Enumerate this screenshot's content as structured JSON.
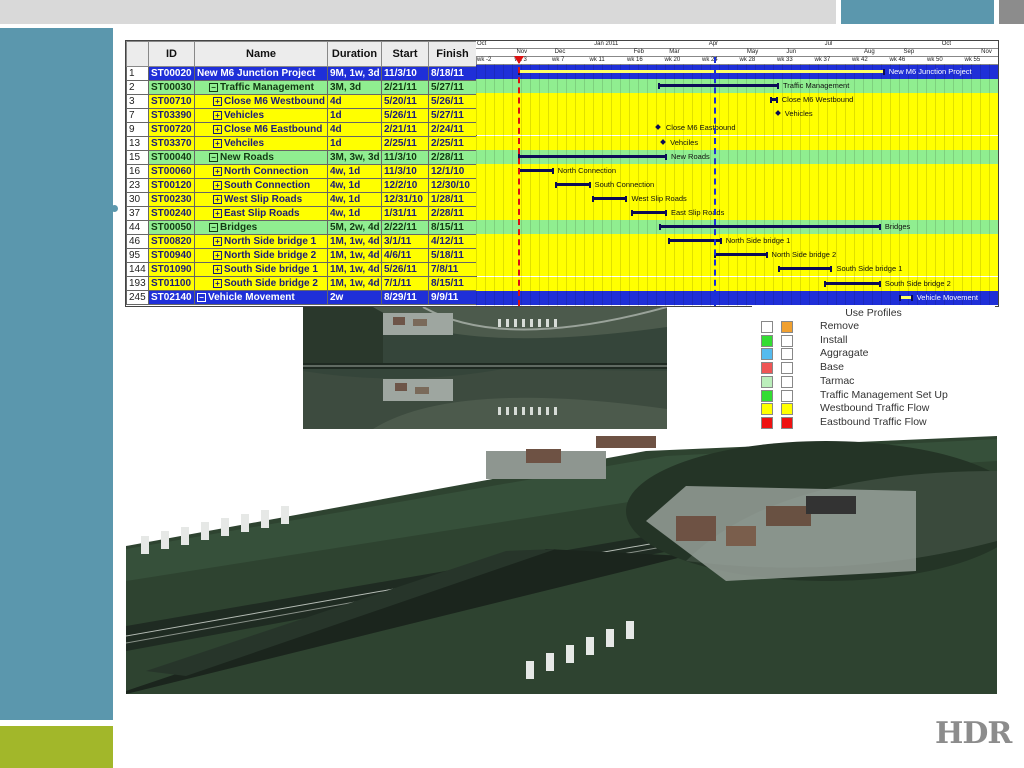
{
  "slide": {
    "logo_text": "HDR",
    "colors": {
      "teal": "#5b97ad",
      "green": "#a2b72a",
      "gray": "#d9d9d9"
    }
  },
  "gantt": {
    "columns": [
      "ID",
      "Name",
      "Duration",
      "Start",
      "Finish"
    ],
    "rows": [
      {
        "num": "1",
        "id": "ST00020",
        "name": "New M6 Junction Project",
        "duration": "9M, 1w, 3d",
        "start": "11/3/10",
        "finish": "8/18/11",
        "type": "project",
        "toggle": "−"
      },
      {
        "num": "2",
        "id": "ST00030",
        "name": "Traffic Management",
        "duration": "3M, 3d",
        "start": "2/21/11",
        "finish": "5/27/11",
        "type": "summary",
        "toggle": "−"
      },
      {
        "num": "3",
        "id": "ST00710",
        "name": "Close M6 Westbound",
        "duration": "4d",
        "start": "5/20/11",
        "finish": "5/26/11",
        "type": "task",
        "toggle": "+"
      },
      {
        "num": "7",
        "id": "ST03390",
        "name": "Vehicles",
        "duration": "1d",
        "start": "5/26/11",
        "finish": "5/27/11",
        "type": "task",
        "toggle": "+"
      },
      {
        "num": "9",
        "id": "ST00720",
        "name": "Close M6 Eastbound",
        "duration": "4d",
        "start": "2/21/11",
        "finish": "2/24/11",
        "type": "task",
        "toggle": "+"
      },
      {
        "num": "13",
        "id": "ST03370",
        "name": "Vehciles",
        "duration": "1d",
        "start": "2/25/11",
        "finish": "2/25/11",
        "type": "task",
        "toggle": "+"
      },
      {
        "num": "15",
        "id": "ST00040",
        "name": "New Roads",
        "duration": "3M, 3w, 3d",
        "start": "11/3/10",
        "finish": "2/28/11",
        "type": "summary",
        "toggle": "−"
      },
      {
        "num": "16",
        "id": "ST00060",
        "name": "North Connection",
        "duration": "4w, 1d",
        "start": "11/3/10",
        "finish": "12/1/10",
        "type": "task",
        "toggle": "+"
      },
      {
        "num": "23",
        "id": "ST00120",
        "name": "South Connection",
        "duration": "4w, 1d",
        "start": "12/2/10",
        "finish": "12/30/10",
        "type": "task",
        "toggle": "+"
      },
      {
        "num": "30",
        "id": "ST00230",
        "name": "West Slip Roads",
        "duration": "4w, 1d",
        "start": "12/31/10",
        "finish": "1/28/11",
        "type": "task",
        "toggle": "+"
      },
      {
        "num": "37",
        "id": "ST00240",
        "name": "East Slip Roads",
        "duration": "4w, 1d",
        "start": "1/31/11",
        "finish": "2/28/11",
        "type": "task",
        "toggle": "+"
      },
      {
        "num": "44",
        "id": "ST00050",
        "name": "Bridges",
        "duration": "5M, 2w, 4d",
        "start": "2/22/11",
        "finish": "8/15/11",
        "type": "summary",
        "toggle": "−"
      },
      {
        "num": "46",
        "id": "ST00820",
        "name": "North Side bridge 1",
        "duration": "1M, 1w, 4d",
        "start": "3/1/11",
        "finish": "4/12/11",
        "type": "task",
        "toggle": "+"
      },
      {
        "num": "95",
        "id": "ST00940",
        "name": "North Side bridge 2",
        "duration": "1M, 1w, 4d",
        "start": "4/6/11",
        "finish": "5/18/11",
        "type": "task",
        "toggle": "+"
      },
      {
        "num": "144",
        "id": "ST01090",
        "name": "South Side bridge 1",
        "duration": "1M, 1w, 4d",
        "start": "5/26/11",
        "finish": "7/8/11",
        "type": "task",
        "toggle": "+"
      },
      {
        "num": "193",
        "id": "ST01100",
        "name": "South Side bridge 2",
        "duration": "1M, 1w, 4d",
        "start": "7/1/11",
        "finish": "8/15/11",
        "type": "task",
        "toggle": "+"
      },
      {
        "num": "245",
        "id": "ST02140",
        "name": "Vehicle Movement",
        "duration": "2w",
        "start": "8/29/11",
        "finish": "9/9/11",
        "type": "move",
        "toggle": "−"
      }
    ],
    "timeline": {
      "year_labels": [
        "Oct",
        "Jan 2011",
        "Apr",
        "Jul",
        "Oct"
      ],
      "month_labels": [
        "Nov",
        "Dec",
        "Feb",
        "Mar",
        "May",
        "Jun",
        "Aug",
        "Sep",
        "Nov"
      ],
      "week_labels": [
        "wk -2",
        "wk 3",
        "wk 7",
        "wk 11",
        "wk 16",
        "wk 20",
        "wk 24",
        "wk 28",
        "wk 33",
        "wk 37",
        "wk 42",
        "wk 46",
        "wk 50",
        "wk 55"
      ]
    },
    "bars": [
      {
        "label": "New M6 Junction Project",
        "start": "11/3/10",
        "finish": "8/18/11"
      },
      {
        "label": "Traffic Management",
        "start": "2/21/11",
        "finish": "5/27/11"
      },
      {
        "label": "Close M6 Westbound",
        "start": "5/20/11",
        "finish": "5/26/11"
      },
      {
        "label": "Vehicles",
        "start": "5/26/11",
        "finish": "5/27/11"
      },
      {
        "label": "Close M6 Eastbound",
        "start": "2/21/11",
        "finish": "2/24/11"
      },
      {
        "label": "Vehciles",
        "start": "2/25/11",
        "finish": "2/25/11"
      },
      {
        "label": "New Roads",
        "start": "11/3/10",
        "finish": "2/28/11"
      },
      {
        "label": "North Connection",
        "start": "11/3/10",
        "finish": "12/1/10"
      },
      {
        "label": "South Connection",
        "start": "12/2/10",
        "finish": "12/30/10"
      },
      {
        "label": "West Slip Roads",
        "start": "12/31/10",
        "finish": "1/28/11"
      },
      {
        "label": "East Slip Roads",
        "start": "1/31/11",
        "finish": "2/28/11"
      },
      {
        "label": "Bridges",
        "start": "2/22/11",
        "finish": "8/15/11"
      },
      {
        "label": "North Side bridge 1",
        "start": "3/1/11",
        "finish": "4/12/11"
      },
      {
        "label": "North Side bridge 2",
        "start": "4/6/11",
        "finish": "5/18/11"
      },
      {
        "label": "South Side bridge 1",
        "start": "5/26/11",
        "finish": "7/8/11"
      },
      {
        "label": "South Side bridge 2",
        "start": "7/1/11",
        "finish": "8/15/11"
      },
      {
        "label": "Vehicle Movement",
        "start": "8/29/11",
        "finish": "9/9/11"
      }
    ],
    "red_line_date": "11/3/10",
    "blue_line_date": "4/6/11"
  },
  "legend": {
    "title": "Use Profiles",
    "items": [
      {
        "label": "Remove",
        "c1": "#ffffff",
        "c2": "#f0a030"
      },
      {
        "label": "Install",
        "c1": "#33dd33",
        "c2": "#ffffff"
      },
      {
        "label": "Aggragate",
        "c1": "#55bbee",
        "c2": "#ffffff"
      },
      {
        "label": "Base",
        "c1": "#ee5555",
        "c2": "#ffffff"
      },
      {
        "label": "Tarmac",
        "c1": "#bbeebb",
        "c2": "#ffffff"
      },
      {
        "label": "Traffic Management Set Up",
        "c1": "#33dd33",
        "c2": "#ffffff"
      },
      {
        "label": "Westbound Traffic Flow",
        "c1": "#ffff00",
        "c2": "#ffff00"
      },
      {
        "label": "Eastbound Traffic Flow",
        "c1": "#ee1111",
        "c2": "#ee1111"
      }
    ]
  }
}
